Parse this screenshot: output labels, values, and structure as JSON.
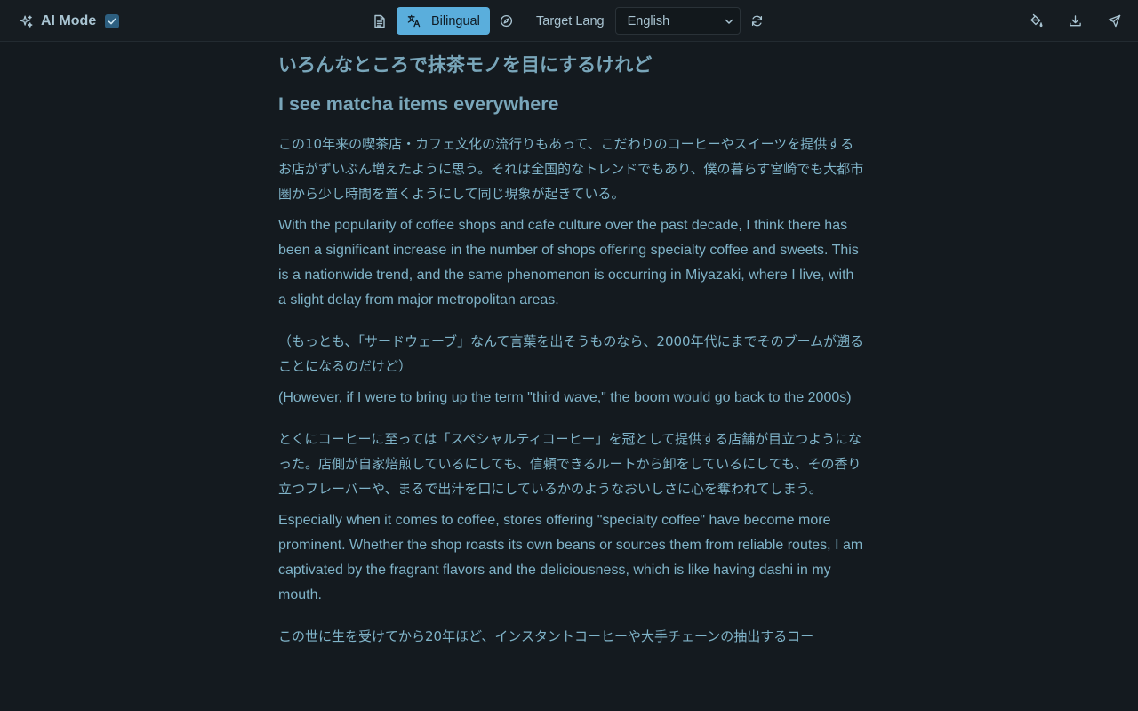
{
  "toolbar": {
    "ai_mode_label": "AI Mode",
    "ai_mode_checked": true,
    "bilingual_label": "Bilingual",
    "target_lang_label": "Target Lang",
    "target_lang_value": "English",
    "icons": {
      "sparkle": "sparkle-icon",
      "checkbox": "checkbox-checked-icon",
      "document": "document-icon",
      "translate": "translate-icon",
      "compass": "compass-icon",
      "chevron": "chevron-down-icon",
      "refresh": "refresh-icon",
      "paint_bucket": "paint-bucket-icon",
      "download": "download-icon",
      "send": "send-icon"
    },
    "accent_color": "#5aaedc"
  },
  "article": {
    "title_jp": "いろんなところで抹茶モノを目にするけれど",
    "title_en": "I see matcha items everywhere",
    "paragraphs": [
      {
        "jp": "この10年来の喫茶店・カフェ文化の流行りもあって、こだわりのコーヒーやスイーツを提供するお店がずいぶん増えたように思う。それは全国的なトレンドでもあり、僕の暮らす宮崎でも大都市圏から少し時間を置くようにして同じ現象が起きている。",
        "en": "With the popularity of coffee shops and cafe culture over the past decade, I think there has been a significant increase in the number of shops offering specialty coffee and sweets. This is a nationwide trend, and the same phenomenon is occurring in Miyazaki, where I live, with a slight delay from major metropolitan areas."
      },
      {
        "jp": "（もっとも、「サードウェーブ」なんて言葉を出そうものなら、2000年代にまでそのブームが遡ることになるのだけど）",
        "en": "(However, if I were to bring up the term \"third wave,\" the boom would go back to the 2000s)"
      },
      {
        "jp": "とくにコーヒーに至っては「スペシャルティコーヒー」を冠として提供する店舗が目立つようになった。店側が自家焙煎しているにしても、信頼できるルートから卸をしているにしても、その香り立つフレーバーや、まるで出汁を口にしているかのようなおいしさに心を奪われてしまう。",
        "en": "Especially when it comes to coffee, stores offering \"specialty coffee\" have become more prominent. Whether the shop roasts its own beans or sources them from reliable routes, I am captivated by the fragrant flavors and the deliciousness, which is like having dashi in my mouth."
      },
      {
        "jp": "この世に生を受けてから20年ほど、インスタントコーヒーや大手チェーンの抽出するコー",
        "en": ""
      }
    ]
  }
}
